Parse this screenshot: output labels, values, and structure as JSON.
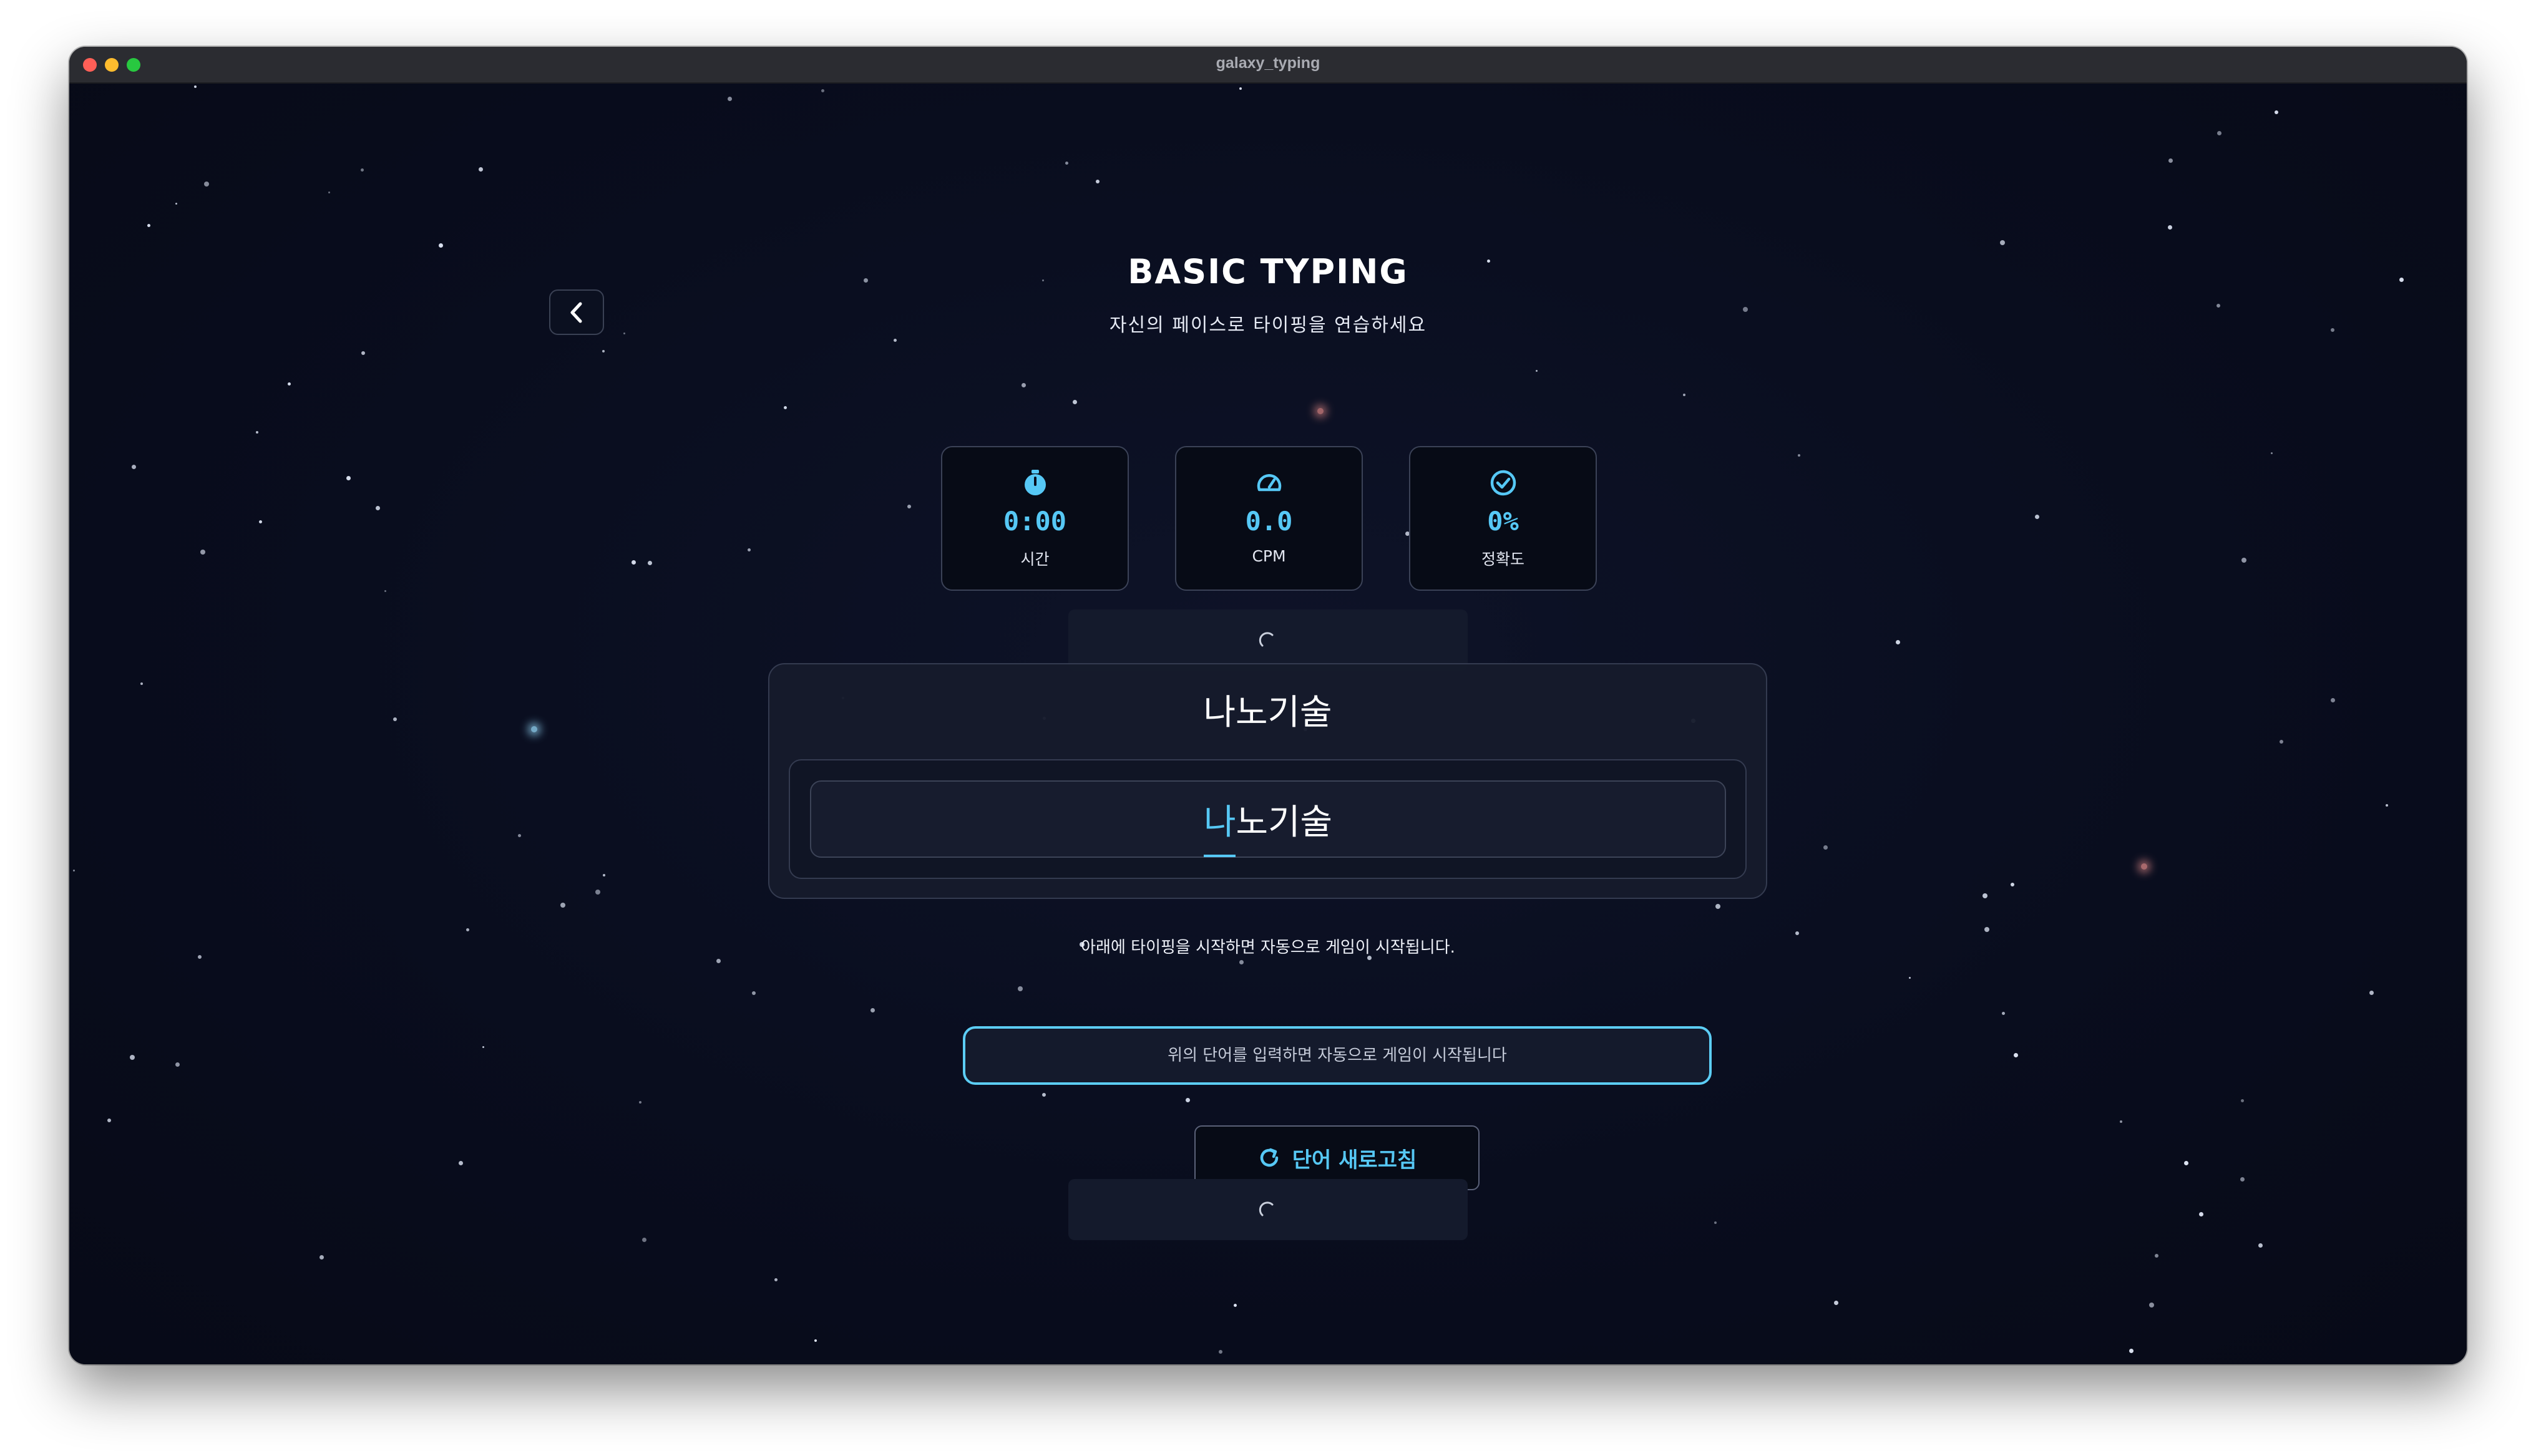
{
  "window": {
    "title": "galaxy_typing"
  },
  "header": {
    "title": "BASIC TYPING",
    "subtitle": "자신의 페이스로 타이핑을 연습하세요"
  },
  "stats": [
    {
      "icon": "stopwatch-icon",
      "value": "0:00",
      "label": "시간"
    },
    {
      "icon": "speedometer-icon",
      "value": "0.0",
      "label": "CPM"
    },
    {
      "icon": "check-circle-icon",
      "value": "0%",
      "label": "정확도"
    }
  ],
  "word": {
    "target": "나노기술",
    "typed_current": "나",
    "typed_rest": "노기술"
  },
  "hint": "아래에 타이핑을 시작하면 자동으로 게임이 시작됩니다.",
  "input": {
    "placeholder": "위의 단어를 입력하면 자동으로 게임이 시작됩니다",
    "value": ""
  },
  "refresh_button": {
    "label": "단어 새로고침"
  },
  "colors": {
    "accent": "#56c8f5",
    "background": "#080c1b",
    "panel": "#161b2c",
    "border": "#343b50"
  }
}
